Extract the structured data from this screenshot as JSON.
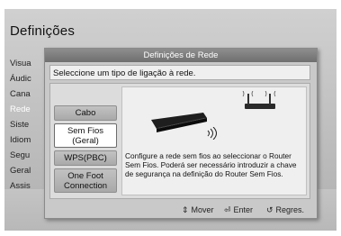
{
  "background": {
    "title": "Definições",
    "menu": [
      "Visua",
      "Áudic",
      "Cana",
      "Rede",
      "Siste",
      "Idiom",
      "Segu",
      "Geral",
      "Assis"
    ]
  },
  "dialog": {
    "title": "Definições de Rede",
    "prompt": "Seleccione um tipo de ligação à rede.",
    "options": [
      {
        "label": "Cabo",
        "selected": false
      },
      {
        "label": "Sem Fios\n(Geral)",
        "selected": true
      },
      {
        "label": "WPS(PBC)",
        "selected": false
      },
      {
        "label": "One Foot\nConnection",
        "selected": false
      }
    ],
    "description": "Configure a rede sem fios ao seleccionar o Router Sem Fios. Poderá ser necessário introduzir a chave de segurança na definição do Router Sem Fios.",
    "footer": {
      "move_icon": "updown-arrows-icon",
      "move_label": "Mover",
      "enter_icon": "enter-icon",
      "enter_label": "Enter",
      "return_icon": "return-icon",
      "return_label": "Regres."
    }
  },
  "colors": {
    "title_bar": "#7a7a7a",
    "selected_option": "#ffffff",
    "panel": "#c9c9c9"
  }
}
